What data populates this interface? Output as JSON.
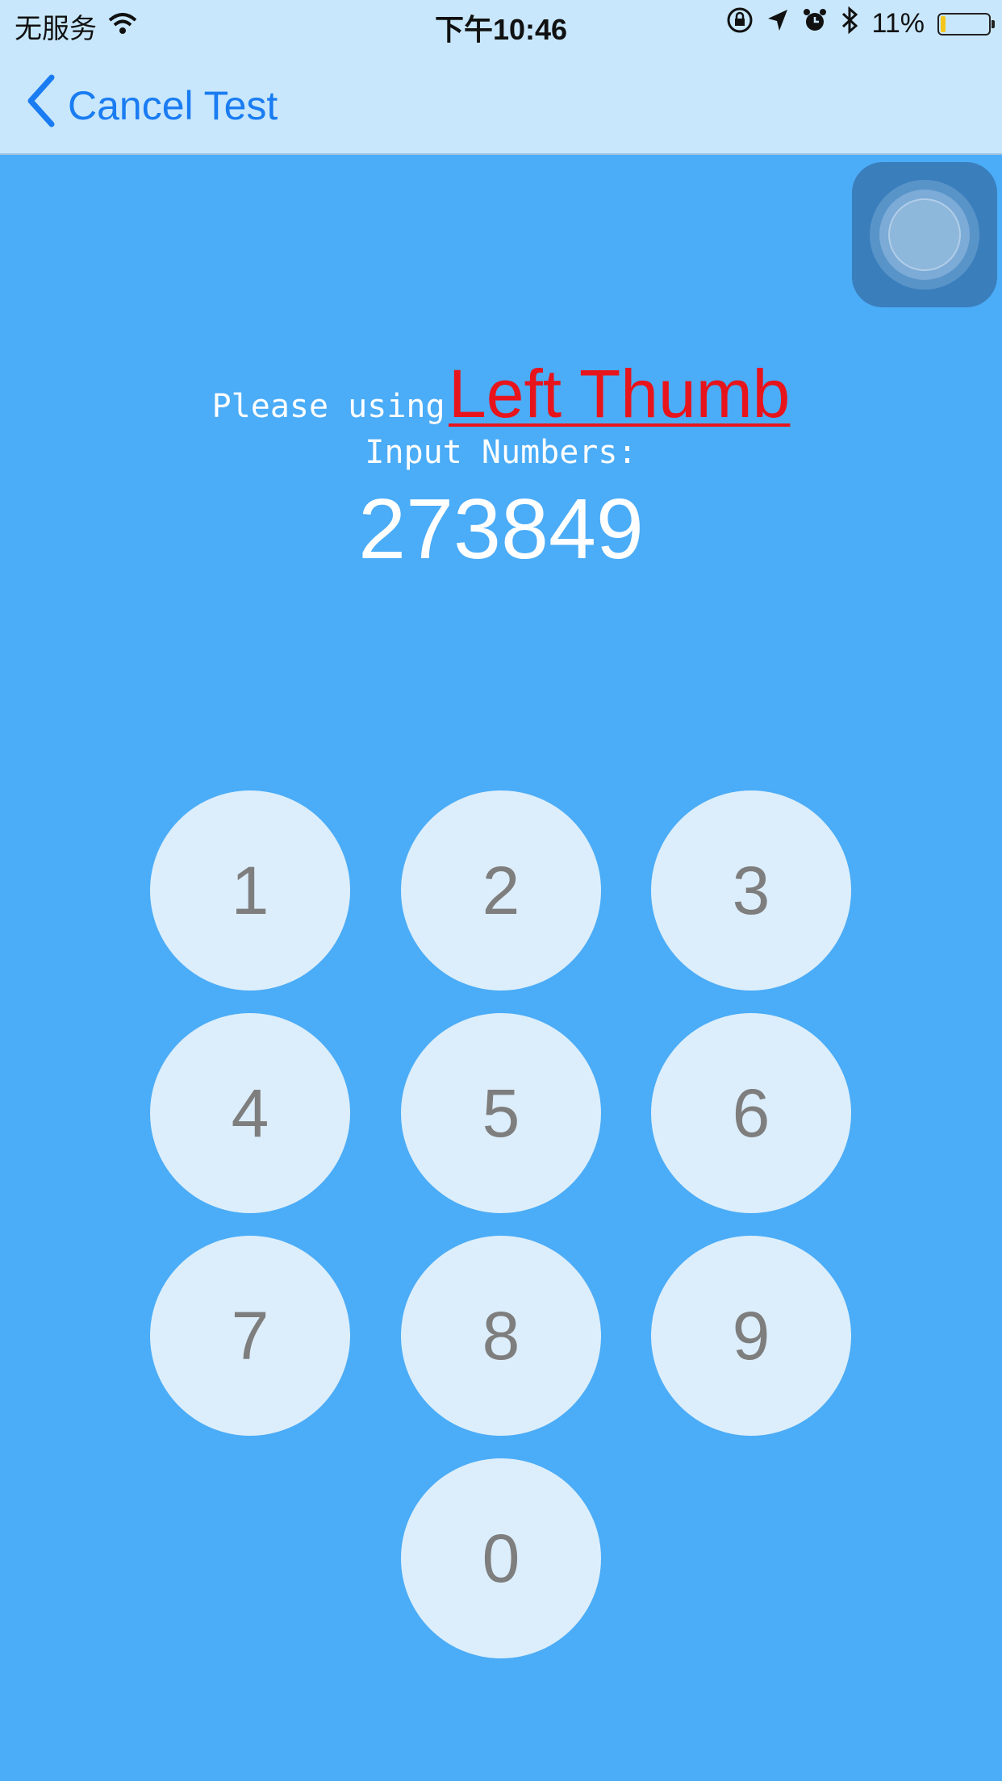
{
  "status_bar": {
    "carrier": "无服务",
    "time": "下午10:46",
    "battery_percent": "11%",
    "battery_level": 0.11,
    "icons": [
      "wifi-icon",
      "orientation-lock-icon",
      "location-icon",
      "alarm-icon",
      "bluetooth-icon",
      "battery-icon"
    ],
    "battery_color": "#F4C61A"
  },
  "nav": {
    "back_label": "Cancel Test",
    "accent_color": "#1A7CF2"
  },
  "instruction": {
    "prefix": "Please using",
    "thumb": "Left Thumb",
    "input_label": "Input Numbers:",
    "target_number": "273849"
  },
  "keypad": {
    "keys": [
      "1",
      "2",
      "3",
      "4",
      "5",
      "6",
      "7",
      "8",
      "9",
      "0"
    ]
  },
  "colors": {
    "background": "#4BACF7",
    "key_background": "#DCEEFB",
    "highlight": "#E8141C"
  }
}
